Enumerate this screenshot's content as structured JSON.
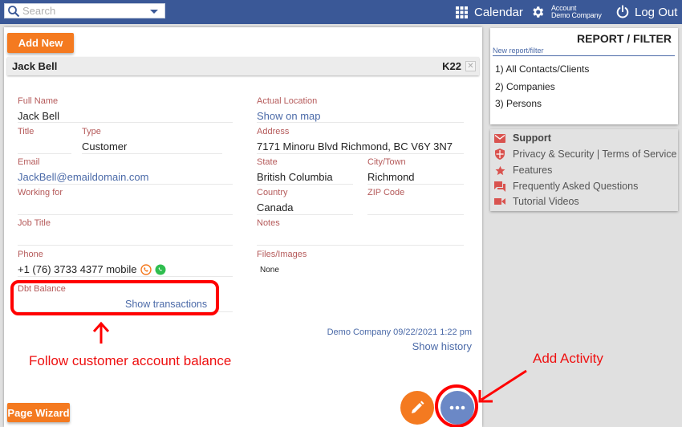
{
  "topbar": {
    "search_placeholder": "Search",
    "calendar_label": "Calendar",
    "account_label": "Account",
    "account_company": "Demo Company",
    "logout_label": "Log Out"
  },
  "main": {
    "add_new_label": "Add New",
    "record": {
      "name": "Jack Bell",
      "code": "K22",
      "close_glyph": "✕"
    },
    "fields": {
      "full_name": {
        "label": "Full Name",
        "value": "Jack Bell"
      },
      "title": {
        "label": "Title",
        "value": ""
      },
      "type": {
        "label": "Type",
        "value": "Customer"
      },
      "email": {
        "label": "Email",
        "value": "JackBell@emaildomain.com"
      },
      "working_for": {
        "label": "Working for",
        "value": ""
      },
      "job_title": {
        "label": "Job Title",
        "value": ""
      },
      "phone": {
        "label": "Phone",
        "value": "+1 (76) 3733 4377 mobile"
      },
      "dbt_balance": {
        "label": "Dbt Balance",
        "link": "Show transactions"
      },
      "actual_location": {
        "label": "Actual Location",
        "link": "Show on map"
      },
      "address": {
        "label": "Address",
        "value": "7171 Minoru Blvd Richmond, BC V6Y 3N7"
      },
      "state": {
        "label": "State",
        "value": "British Columbia"
      },
      "city": {
        "label": "City/Town",
        "value": "Richmond"
      },
      "country": {
        "label": "Country",
        "value": "Canada"
      },
      "zip": {
        "label": "ZIP Code",
        "value": ""
      },
      "notes": {
        "label": "Notes",
        "value": ""
      },
      "files": {
        "label": "Files/Images",
        "value": "None"
      }
    },
    "meta": "Demo Company 09/22/2021 1:22 pm",
    "show_history_label": "Show history",
    "page_wizard_label": "Page Wizard"
  },
  "report": {
    "title": "REPORT / FILTER",
    "new_link": "New report/filter",
    "items": [
      "1) All Contacts/Clients",
      "2) Companies",
      "3) Persons"
    ]
  },
  "support": {
    "items": [
      {
        "label": "Support",
        "icon": "mail-icon"
      },
      {
        "label": "Privacy & Security | Terms of Service",
        "icon": "shield-icon"
      },
      {
        "label": "Features",
        "icon": "star-icon"
      },
      {
        "label": "Frequently Asked Questions",
        "icon": "forum-icon"
      },
      {
        "label": "Tutorial Videos",
        "icon": "video-icon"
      }
    ],
    "icon_color": "#d9534f"
  },
  "annotations": {
    "balance_note": "Follow customer account balance",
    "activity_note": "Add Activity",
    "color": "#ff0000"
  },
  "colors": {
    "topbar": "#3a5897",
    "accent_orange": "#f47a20",
    "fab_blue": "#6b88c6",
    "label_red": "#b55a5a",
    "link_blue": "#4b6aa8"
  }
}
